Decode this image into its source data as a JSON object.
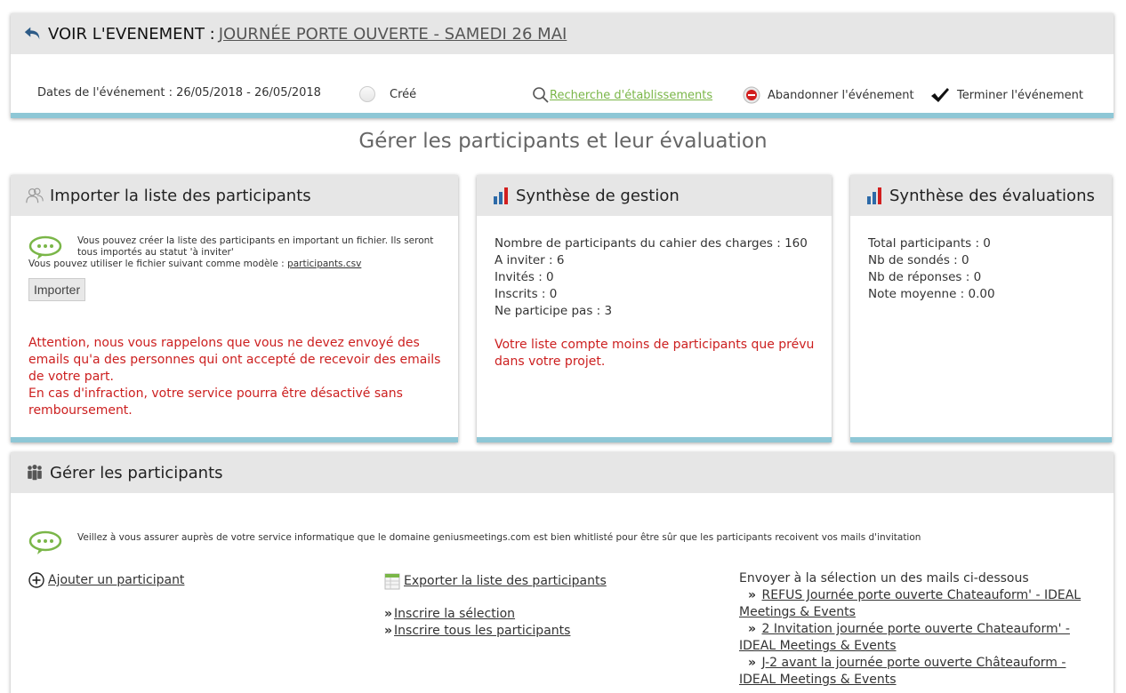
{
  "event": {
    "label": "VOIR L'EVENEMENT :",
    "name": "JOURNÉE PORTE OUVERTE - SAMEDI 26 MAI",
    "dates": "Dates de l'événement : 26/05/2018 - 26/05/2018",
    "status": "Créé",
    "search_link": "Recherche d'établissements",
    "abandon": "Abandonner l'événement",
    "finish": "Terminer l'événement"
  },
  "section_title": "Gérer les participants et leur évaluation",
  "import": {
    "title": "Importer la liste des participants",
    "info_line1": "Vous pouvez créer la liste des participants en important un fichier. Ils seront tous importés au statut 'à inviter'",
    "info_line2_prefix": "Vous pouvez utiliser le fichier suivant comme modèle : ",
    "info_file": "participants.csv",
    "button": "Importer",
    "warning_1": "Attention, nous vous rappelons que vous ne devez envoyé des emails qu'a des personnes qui ont accepté de recevoir des emails de votre part.",
    "warning_2": "En cas d'infraction, votre service pourra être désactivé sans remboursement."
  },
  "gestion": {
    "title": "Synthèse de gestion",
    "stats": [
      "Nombre de participants du cahier des charges : 160",
      "A inviter : 6",
      "Invités : 0",
      "Inscrits : 0",
      "Ne participe pas : 3"
    ],
    "alert": "Votre liste compte moins de participants que prévu dans votre projet."
  },
  "evaluations": {
    "title": "Synthèse des évaluations",
    "stats": [
      "Total participants : 0",
      "Nb de sondés : 0",
      "Nb de réponses : 0",
      "Note moyenne : 0.00"
    ]
  },
  "manage": {
    "title": "Gérer les participants",
    "info": "Veillez à vous assurer auprès de votre service informatique que le domaine geniusmeetings.com est bien whitlisté pour être sûr que les participants recoivent vos mails d'invitation",
    "add": "Ajouter un participant",
    "export": "Exporter la liste des participants",
    "register_selection": "Inscrire la sélection",
    "register_all": "Inscrire tous les participants",
    "send_label": "Envoyer à la sélection un des mails ci-dessous",
    "mails": [
      "REFUS Journée porte ouverte Chateauform' - IDEAL Meetings & Events",
      "2 Invitation journée porte ouverte Chateauform' - IDEAL Meetings & Events",
      "J-2 avant la journée porte ouverte Châteauform - IDEAL Meetings & Events"
    ]
  },
  "colors": {
    "accent_bar": "#8ec7d6",
    "alert_red": "#cc1f1f",
    "link_green": "#7ab648",
    "header_gray": "#e6e6e6"
  }
}
